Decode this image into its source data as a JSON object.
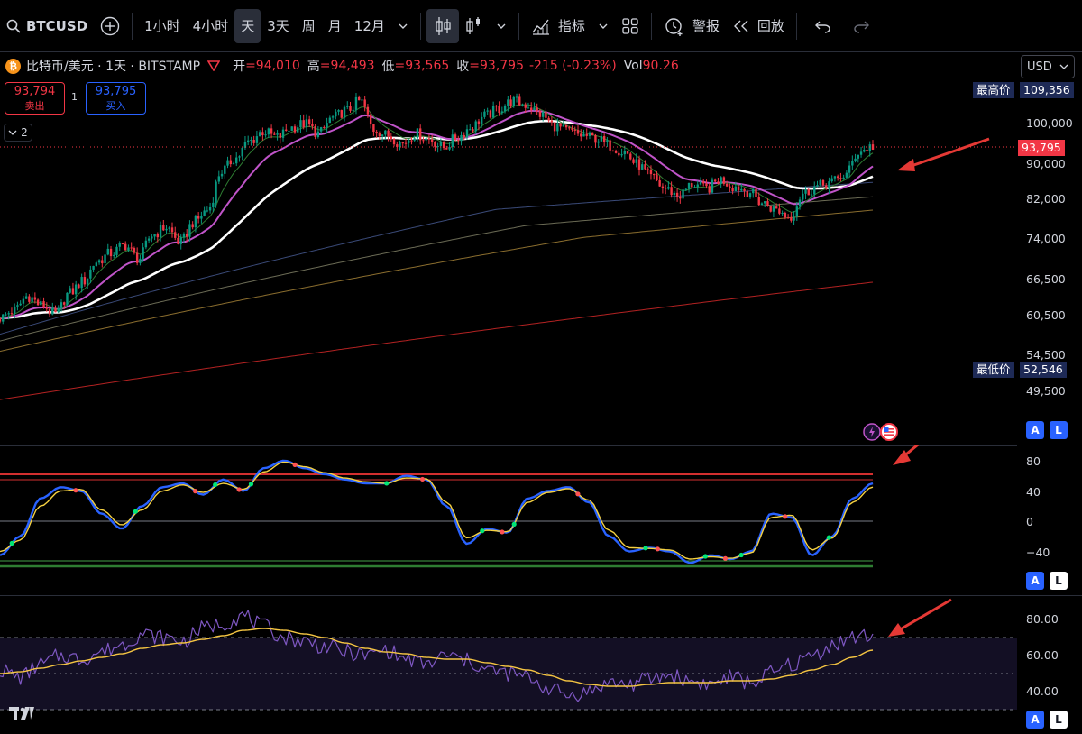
{
  "toolbar": {
    "symbol": "BTCUSD",
    "intervals": [
      "1小时",
      "4小时",
      "天",
      "3天",
      "周",
      "月",
      "12月"
    ],
    "active_interval": "天",
    "indicators_label": "指标",
    "alert_label": "警报",
    "replay_label": "回放"
  },
  "legend": {
    "title": "比特币/美元 · 1天 · BITSTAMP",
    "open_label": "开",
    "open": "94,010",
    "high_label": "高",
    "high": "94,493",
    "low_label": "低",
    "low": "93,565",
    "close_label": "收",
    "close": "93,795",
    "change": "-215 (-0.23%)",
    "vol_label": "Vol",
    "vol": "90.26"
  },
  "trade": {
    "sell_price": "93,794",
    "sell_label": "卖出",
    "buy_price": "93,795",
    "buy_label": "买入",
    "spread": "1",
    "collapse": "2"
  },
  "currency": "USD",
  "price_axis": {
    "high_label": "最高价",
    "high_value": "109,356",
    "low_label": "最低价",
    "low_value": "52,546",
    "current": "93,795",
    "ticks": [
      "100,000",
      "90,000",
      "82,000",
      "74,000",
      "66,500",
      "60,500",
      "54,500",
      "49,500"
    ]
  },
  "osc_axis": {
    "ticks": [
      "80",
      "40",
      "0",
      "−40"
    ]
  },
  "rsi_axis": {
    "ticks": [
      "80.00",
      "60.00",
      "40.00"
    ]
  },
  "pane_buttons": {
    "auto": "A",
    "log": "L"
  },
  "colors": {
    "up": "#089981",
    "down": "#f23645",
    "ema_white": "#ffffff",
    "ema_purple": "#c054c9",
    "osc_fast": "#2962ff",
    "osc_slow": "#f5d142",
    "rsi": "#7e57c2",
    "rsi_ma": "#f5c542",
    "annotation": "#e53935"
  },
  "chart_data": {
    "type": "line",
    "price_candles_approx": [
      60000,
      61200,
      63500,
      62000,
      60500,
      64000,
      66000,
      69500,
      71000,
      72500,
      70000,
      74500,
      76000,
      73000,
      77000,
      79500,
      88000,
      91000,
      95000,
      97500,
      96000,
      98500,
      99500,
      97000,
      101000,
      103000,
      105500,
      98000,
      96500,
      94500,
      97000,
      95500,
      93500,
      96000,
      98500,
      101500,
      103500,
      105500,
      104500,
      102000,
      99000,
      97500,
      96500,
      95800,
      94000,
      92500,
      89500,
      86500,
      84000,
      82500,
      85000,
      84000,
      86000,
      84500,
      83500,
      81000,
      79500,
      78000,
      83000,
      84500,
      85500,
      87000,
      92500,
      93795
    ],
    "oscillator_fast": [
      -45,
      -20,
      30,
      45,
      40,
      10,
      -10,
      20,
      45,
      50,
      35,
      55,
      40,
      70,
      80,
      70,
      62,
      55,
      50,
      50,
      60,
      55,
      20,
      -30,
      -10,
      -15,
      30,
      40,
      45,
      25,
      -20,
      -40,
      -35,
      -40,
      -55,
      -45,
      -50,
      -40,
      10,
      5,
      -45,
      -20,
      30,
      50
    ],
    "oscillator_slow": [
      -40,
      -25,
      20,
      40,
      42,
      15,
      -5,
      15,
      40,
      48,
      38,
      50,
      42,
      65,
      78,
      72,
      64,
      57,
      52,
      50,
      57,
      56,
      25,
      -22,
      -12,
      -14,
      25,
      38,
      43,
      28,
      -12,
      -35,
      -36,
      -38,
      -50,
      -47,
      -49,
      -42,
      5,
      8,
      -38,
      -22,
      25,
      45
    ],
    "rsi": [
      52,
      48,
      55,
      60,
      58,
      62,
      66,
      72,
      70,
      68,
      75,
      78,
      82,
      76,
      70,
      68,
      65,
      62,
      60,
      63,
      58,
      55,
      60,
      57,
      52,
      50,
      48,
      42,
      38,
      40,
      45,
      44,
      47,
      49,
      46,
      44,
      48,
      45,
      50,
      55,
      60,
      66,
      70,
      71
    ],
    "rsi_ma": [
      50,
      51,
      53,
      55,
      57,
      59,
      61,
      64,
      66,
      67,
      69,
      71,
      74,
      75,
      74,
      72,
      70,
      67,
      64,
      62,
      61,
      59,
      58,
      58,
      56,
      54,
      52,
      49,
      46,
      44,
      43,
      43,
      44,
      45,
      45,
      45,
      46,
      46,
      47,
      49,
      52,
      55,
      59,
      63
    ]
  }
}
